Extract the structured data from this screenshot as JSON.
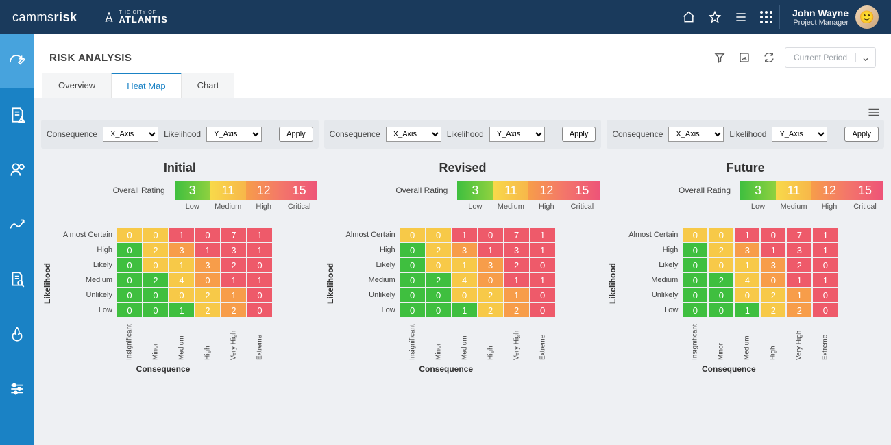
{
  "header": {
    "brand_main_light": "camms",
    "brand_main_bold": "risk",
    "city_line1": "THE CITY OF",
    "city_line2": "ATLANTIS",
    "user_name": "John Wayne",
    "user_role": "Project Manager"
  },
  "page": {
    "title": "RISK ANALYSIS",
    "period_placeholder": "Current Period"
  },
  "tabs": [
    "Overview",
    "Heat Map",
    "Chart"
  ],
  "active_tab": 1,
  "controls": {
    "consequence_label": "Consequence",
    "consequence_value": "X_Axis",
    "likelihood_label": "Likelihood",
    "likelihood_value": "Y_Axis",
    "apply": "Apply"
  },
  "rating": {
    "label": "Overall Rating",
    "cells": [
      {
        "value": "3",
        "bg": "linear-gradient(90deg,#3fbf3f,#8fd13f)",
        "label": "Low"
      },
      {
        "value": "11",
        "bg": "linear-gradient(90deg,#f8d94a,#f7b74a)",
        "label": "Medium"
      },
      {
        "value": "12",
        "bg": "linear-gradient(90deg,#f79d4a,#f3766a)",
        "label": "High"
      },
      {
        "value": "15",
        "bg": "linear-gradient(90deg,#f3766a,#ee5478)",
        "label": "Critical"
      }
    ]
  },
  "axis": {
    "y_title": "Likelihood",
    "x_title": "Consequence",
    "y_labels": [
      "Almost Certain",
      "High",
      "Likely",
      "Medium",
      "Unlikely",
      "Low"
    ],
    "x_labels": [
      "Insignificant",
      "Minor",
      "Medium",
      "High",
      "Very High",
      "Extreme"
    ]
  },
  "panels": [
    {
      "title": "Initial"
    },
    {
      "title": "Revised"
    },
    {
      "title": "Future"
    }
  ],
  "chart_data": {
    "type": "heatmap",
    "x_categories": [
      "Insignificant",
      "Minor",
      "Medium",
      "High",
      "Very High",
      "Extreme"
    ],
    "y_categories": [
      "Almost Certain",
      "High",
      "Likely",
      "Medium",
      "Unlikely",
      "Low"
    ],
    "xlabel": "Consequence",
    "ylabel": "Likelihood",
    "colors": {
      "low": "#3fbf3f",
      "medium": "#f7c948",
      "high": "#f79d4a",
      "critical": "#ee5a6a"
    },
    "grid": [
      {
        "row": "Almost Certain",
        "cells": [
          {
            "v": 0,
            "c": "medium"
          },
          {
            "v": 0,
            "c": "medium"
          },
          {
            "v": 1,
            "c": "critical"
          },
          {
            "v": 0,
            "c": "critical"
          },
          {
            "v": 7,
            "c": "critical"
          },
          {
            "v": 1,
            "c": "critical"
          }
        ]
      },
      {
        "row": "High",
        "cells": [
          {
            "v": 0,
            "c": "low"
          },
          {
            "v": 2,
            "c": "medium"
          },
          {
            "v": 3,
            "c": "high"
          },
          {
            "v": 1,
            "c": "critical"
          },
          {
            "v": 3,
            "c": "critical"
          },
          {
            "v": 1,
            "c": "critical"
          }
        ]
      },
      {
        "row": "Likely",
        "cells": [
          {
            "v": 0,
            "c": "low"
          },
          {
            "v": 0,
            "c": "medium"
          },
          {
            "v": 1,
            "c": "medium"
          },
          {
            "v": 3,
            "c": "high"
          },
          {
            "v": 2,
            "c": "critical"
          },
          {
            "v": 0,
            "c": "critical"
          }
        ]
      },
      {
        "row": "Medium",
        "cells": [
          {
            "v": 0,
            "c": "low"
          },
          {
            "v": 2,
            "c": "low"
          },
          {
            "v": 4,
            "c": "medium"
          },
          {
            "v": 0,
            "c": "high"
          },
          {
            "v": 1,
            "c": "critical"
          },
          {
            "v": 1,
            "c": "critical"
          }
        ]
      },
      {
        "row": "Unlikely",
        "cells": [
          {
            "v": 0,
            "c": "low"
          },
          {
            "v": 0,
            "c": "low"
          },
          {
            "v": 0,
            "c": "medium"
          },
          {
            "v": 2,
            "c": "medium"
          },
          {
            "v": 1,
            "c": "high"
          },
          {
            "v": 0,
            "c": "critical"
          }
        ]
      },
      {
        "row": "Low",
        "cells": [
          {
            "v": 0,
            "c": "low"
          },
          {
            "v": 0,
            "c": "low"
          },
          {
            "v": 1,
            "c": "low"
          },
          {
            "v": 2,
            "c": "medium"
          },
          {
            "v": 2,
            "c": "high"
          },
          {
            "v": 0,
            "c": "critical"
          }
        ]
      }
    ],
    "note": "Same grid repeated for Initial, Revised, Future panels"
  }
}
